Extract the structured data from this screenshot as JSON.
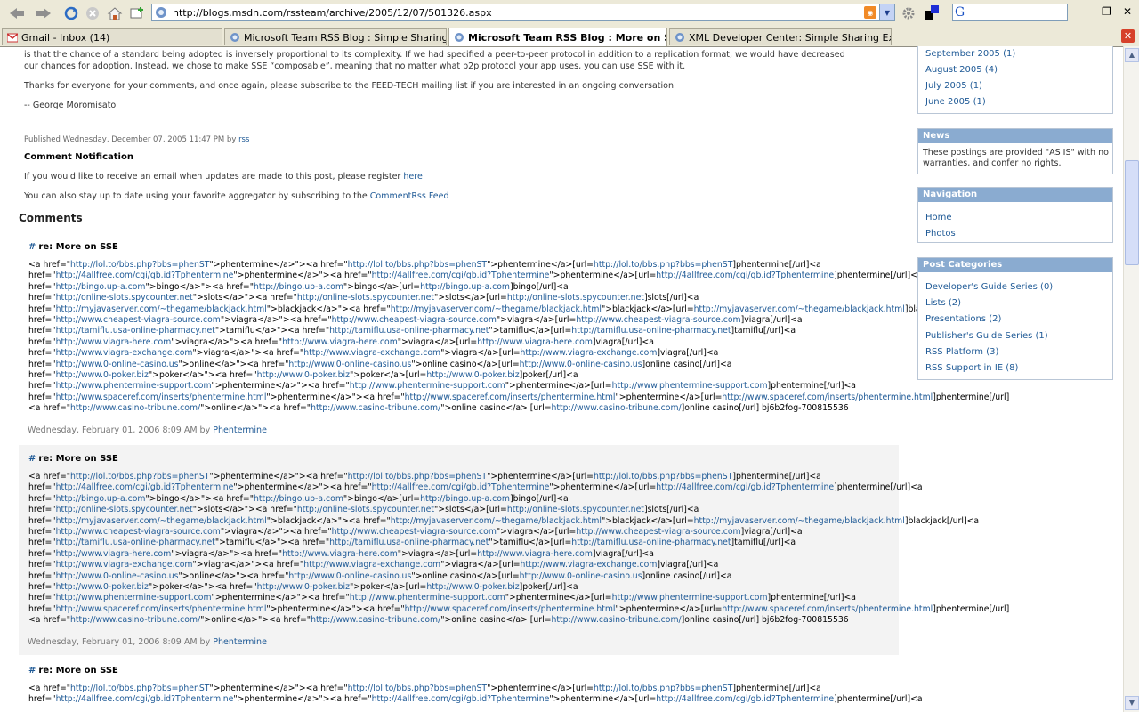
{
  "browser": {
    "url": "http://blogs.msdn.com/rssteam/archive/2005/12/07/501326.aspx",
    "tabs": [
      {
        "label": "Gmail - Inbox (14)"
      },
      {
        "label": "Microsoft Team RSS Blog : Simple Sharing E..."
      },
      {
        "label": "Microsoft Team RSS Blog : More on SSE"
      },
      {
        "label": "XML Developer Center: Simple Sharing Exte..."
      }
    ],
    "search_logo": "G",
    "tab_close": "✕"
  },
  "post": {
    "intro_line1": "is that the chance of a standard being adopted is inversely proportional to its complexity. If we had specified a peer-to-peer protocol in addition to a replication format, we would have decreased",
    "intro_line2": "our chances for adoption. Instead, we chose to make SSE “composable”, meaning that no matter what p2p protocol your app uses, you can use SSE with it.",
    "thanks": "Thanks for everyone for your comments, and once again, please subscribe to the FEED-TECH mailing list if you are interested in an ongoing conversation.",
    "signature": "-- George Moromisato",
    "published": "Published Wednesday, December 07, 2005 11:47 PM by",
    "author": "rss",
    "notification_heading": "Comment Notification",
    "notify_text": "If you would like to receive an email when updates are made to this post, please register",
    "notify_link": "here",
    "aggregator_text": "You can also stay up to date using your favorite aggregator by subscribing to the",
    "aggregator_link": "CommentRss Feed"
  },
  "comments_heading": "Comments",
  "comment_lines": [
    "<a href=\"http://lol.to/bbs.php?bbs=phenST\">phentermine</a>\"><a href=\"http://lol.to/bbs.php?bbs=phenST\">phentermine</a>[url=http://lol.to/bbs.php?bbs=phenST]phentermine[/url]<a",
    "href=\"http://4allfree.com/cgi/gb.id?Tphentermine\">phentermine</a>\"><a href=\"http://4allfree.com/cgi/gb.id?Tphentermine\">phentermine</a>[url=http://4allfree.com/cgi/gb.id?Tphentermine]phentermine[/url]<a",
    "href=\"http://bingo.up-a.com\">bingo</a>\"><a href=\"http://bingo.up-a.com\">bingo</a>[url=http://bingo.up-a.com]bingo[/url]<a",
    "href=\"http://online-slots.spycounter.net\">slots</a>\"><a href=\"http://online-slots.spycounter.net\">slots</a>[url=http://online-slots.spycounter.net]slots[/url]<a",
    "href=\"http://myjavaserver.com/~thegame/blackjack.html\">blackjack</a>\"><a href=\"http://myjavaserver.com/~thegame/blackjack.html\">blackjack</a>[url=http://myjavaserver.com/~thegame/blackjack.html]blackjack[/url]<a",
    "href=\"http://www.cheapest-viagra-source.com\">viagra</a>\"><a href=\"http://www.cheapest-viagra-source.com\">viagra</a>[url=http://www.cheapest-viagra-source.com]viagra[/url]<a",
    "href=\"http://tamiflu.usa-online-pharmacy.net\">tamiflu</a>\"><a href=\"http://tamiflu.usa-online-pharmacy.net\">tamiflu</a>[url=http://tamiflu.usa-online-pharmacy.net]tamiflu[/url]<a",
    "href=\"http://www.viagra-here.com\">viagra</a>\"><a href=\"http://www.viagra-here.com\">viagra</a>[url=http://www.viagra-here.com]viagra[/url]<a",
    "href=\"http://www.viagra-exchange.com\">viagra</a>\"><a href=\"http://www.viagra-exchange.com\">viagra</a>[url=http://www.viagra-exchange.com]viagra[/url]<a",
    "href=\"http://www.0-online-casino.us\">online</a>\"><a href=\"http://www.0-online-casino.us\">online casino</a>[url=http://www.0-online-casino.us]online casino[/url]<a",
    "href=\"http://www.0-poker.biz\">poker</a>\"><a href=\"http://www.0-poker.biz\">poker</a>[url=http://www.0-poker.biz]poker[/url]<a",
    "href=\"http://www.phentermine-support.com\">phentermine</a>\"><a href=\"http://www.phentermine-support.com\">phentermine</a>[url=http://www.phentermine-support.com]phentermine[/url]<a",
    "href=\"http://www.spaceref.com/inserts/phentermine.html\">phentermine</a>\"><a href=\"http://www.spaceref.com/inserts/phentermine.html\">phentermine</a>[url=http://www.spaceref.com/inserts/phentermine.html]phentermine[/url]",
    "<a href=\"http://www.casino-tribune.com/\">online</a>\"><a href=\"http://www.casino-tribune.com/\">online casino</a> [url=http://www.casino-tribune.com/]online casino[/url] bj6b2fog-700815536"
  ],
  "comments": [
    {
      "title": "re: More on SSE",
      "hash": "#",
      "date": "Wednesday, February 01, 2006 8:09 AM by",
      "author": "Phentermine"
    },
    {
      "title": "re: More on SSE",
      "hash": "#",
      "date": "Wednesday, February 01, 2006 8:09 AM by",
      "author": "Phentermine"
    },
    {
      "title": "re: More on SSE",
      "hash": "#"
    }
  ],
  "third_comment_lines": [
    "<a href=\"http://lol.to/bbs.php?bbs=phenST\">phentermine</a>\"><a href=\"http://lol.to/bbs.php?bbs=phenST\">phentermine</a>[url=http://lol.to/bbs.php?bbs=phenST]phentermine[/url]<a",
    "href=\"http://4allfree.com/cgi/gb.id?Tphentermine\">phentermine</a>\"><a href=\"http://4allfree.com/cgi/gb.id?Tphentermine\">phentermine</a>[url=http://4allfree.com/cgi/gb.id?Tphentermine]phentermine[/url]<a"
  ],
  "sidebar": {
    "archive_items": [
      "September 2005 (1)",
      "August 2005 (4)",
      "July 2005 (1)",
      "June 2005 (1)"
    ],
    "news_heading": "News",
    "news_text": "These postings are provided \"AS IS\" with no warranties, and confer no rights.",
    "navigation_heading": "Navigation",
    "navigation_items": [
      "Home",
      "Photos"
    ],
    "categories_heading": "Post Categories",
    "categories": [
      "Developer's Guide Series (0)",
      "Lists (2)",
      "Presentations (2)",
      "Publisher's Guide Series (1)",
      "RSS Platform (3)",
      "RSS Support in IE (8)"
    ]
  },
  "colors": {
    "link": "#1f5a96",
    "sidebar_header": "#8aabd0",
    "comment_alt_bg": "#f3f3f3"
  }
}
